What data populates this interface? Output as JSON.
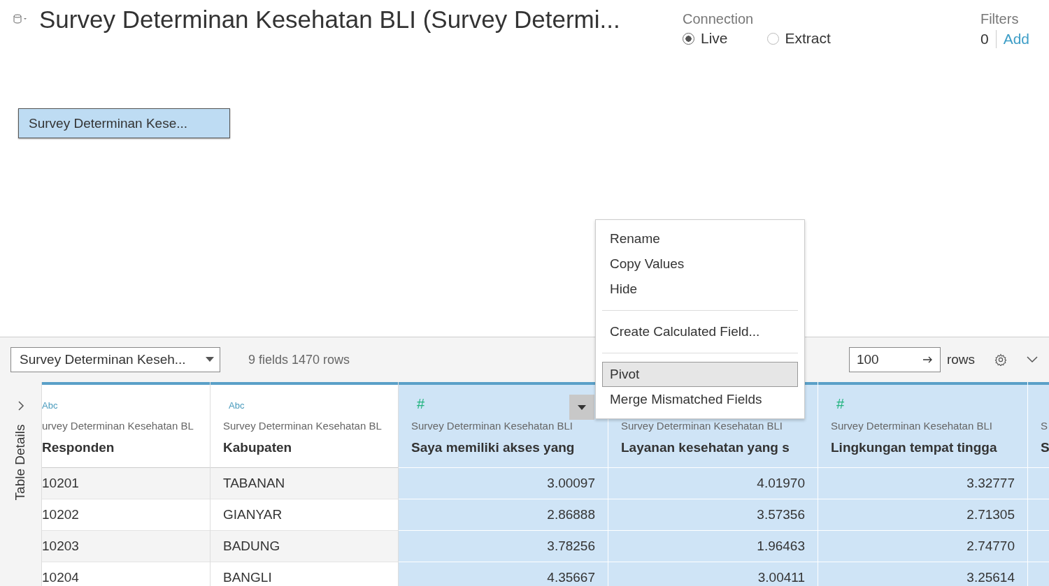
{
  "title": "Survey Determinan Kesehatan BLI (Survey Determi...",
  "connection": {
    "label": "Connection",
    "options": [
      {
        "label": "Live",
        "selected": true
      },
      {
        "label": "Extract",
        "selected": false
      }
    ]
  },
  "filters": {
    "label": "Filters",
    "count": "0",
    "add": "Add"
  },
  "canvas_table": "Survey Determinan Kese...",
  "toolbar": {
    "table_select": "Survey Determinan Keseh...",
    "summary": "9 fields 1470 rows",
    "rows_value": "100",
    "rows_label": "rows"
  },
  "side_panel": "Table Details",
  "columns": [
    {
      "kind": "text",
      "type_label": "Abc",
      "source": "urvey Determinan Kesehatan BL",
      "name": "Responden",
      "cells": [
        "10201",
        "10202",
        "10203",
        "10204"
      ]
    },
    {
      "kind": "text",
      "type_label": "Abc",
      "source": "Survey Determinan Kesehatan BL",
      "name": "Kabupaten",
      "cells": [
        "TABANAN",
        "GIANYAR",
        "BADUNG",
        "BANGLI"
      ]
    },
    {
      "kind": "number",
      "type_label": "#",
      "source": "Survey Determinan Kesehatan BLI",
      "name": "Saya memiliki akses yang",
      "cells": [
        "3.00097",
        "2.86888",
        "3.78256",
        "4.35667"
      ]
    },
    {
      "kind": "number",
      "source": "Survey Determinan Kesehatan BLI",
      "name": "Layanan kesehatan yang s",
      "cells": [
        "4.01970",
        "3.57356",
        "1.96463",
        "3.00411"
      ]
    },
    {
      "kind": "number",
      "type_label": "#",
      "source": "Survey Determinan Kesehatan BLI",
      "name": "Lingkungan tempat tingga",
      "cells": [
        "3.32777",
        "2.71305",
        "2.74770",
        "3.25614"
      ]
    },
    {
      "kind": "number",
      "source": "S",
      "name": "S"
    }
  ],
  "context_menu": [
    [
      {
        "label": "Rename",
        "selected": false
      },
      {
        "label": "Copy Values",
        "selected": false
      },
      {
        "label": "Hide",
        "selected": false
      }
    ],
    [
      {
        "label": "Create Calculated Field...",
        "selected": false
      }
    ],
    [
      {
        "label": "Pivot",
        "selected": true
      },
      {
        "label": "Merge Mismatched Fields",
        "selected": false
      }
    ]
  ]
}
